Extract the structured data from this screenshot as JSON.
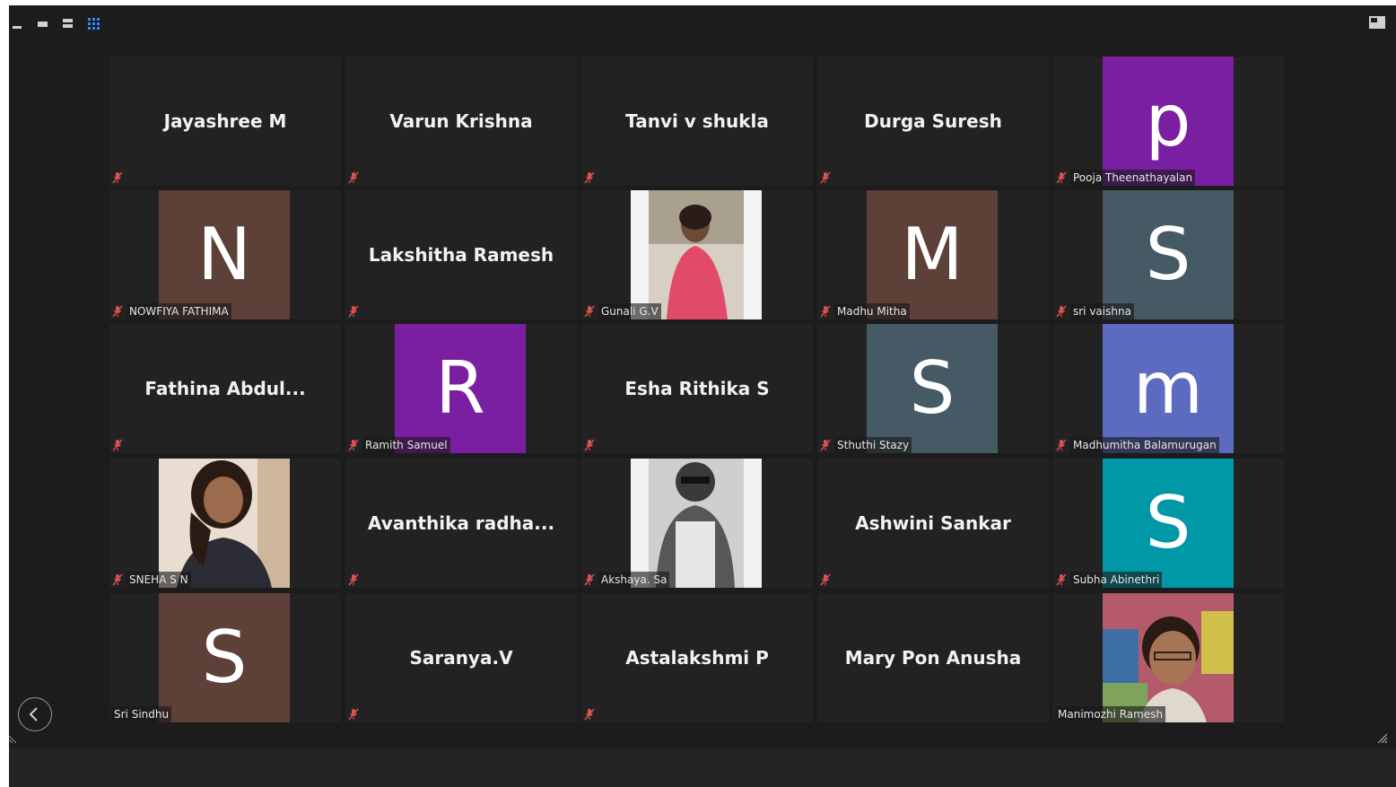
{
  "toolbar": {
    "icons": [
      "minimize-icon",
      "speaker-view-icon",
      "strip-view-icon",
      "gallery-view-icon",
      "exit-fullscreen-icon"
    ],
    "active_color": "#2d8cff"
  },
  "tiles": [
    {
      "kind": "text",
      "name": "Jayashree M",
      "muted": true
    },
    {
      "kind": "text",
      "name": "Varun Krishna",
      "muted": true
    },
    {
      "kind": "text",
      "name": "Tanvi v shukla",
      "muted": true
    },
    {
      "kind": "text",
      "name": "Durga Suresh",
      "muted": true
    },
    {
      "kind": "avatar",
      "letter": "p",
      "color": "#7b1fa2",
      "label": "Pooja Theenathayalan",
      "muted": true
    },
    {
      "kind": "avatar",
      "letter": "N",
      "color": "#5d4037",
      "label": "NOWFIYA FATHIMA",
      "muted": true
    },
    {
      "kind": "text",
      "name": "Lakshitha Ramesh",
      "muted": true
    },
    {
      "kind": "photo",
      "label": "Gunali G.V",
      "muted": true
    },
    {
      "kind": "avatar",
      "letter": "M",
      "color": "#5d4037",
      "label": "Madhu Mitha",
      "muted": true
    },
    {
      "kind": "avatar",
      "letter": "S",
      "color": "#455a64",
      "label": "sri vaishna",
      "muted": true
    },
    {
      "kind": "text",
      "name": "Fathina  Abdul...",
      "muted": true
    },
    {
      "kind": "avatar",
      "letter": "R",
      "color": "#7b1fa2",
      "label": "Ramith Samuel",
      "muted": true
    },
    {
      "kind": "text",
      "name": "Esha Rithika S",
      "muted": true
    },
    {
      "kind": "avatar",
      "letter": "S",
      "color": "#455a64",
      "label": "Sthuthi Stazy",
      "muted": true
    },
    {
      "kind": "avatar",
      "letter": "m",
      "color": "#5c6bc0",
      "label": "Madhumitha Balamurugan",
      "muted": true
    },
    {
      "kind": "photo",
      "label": "SNEHA S N",
      "muted": true
    },
    {
      "kind": "text",
      "name": "Avanthika  radha...",
      "muted": true
    },
    {
      "kind": "photo",
      "label": "Akshaya. Sa",
      "muted": true
    },
    {
      "kind": "text",
      "name": "Ashwini Sankar",
      "muted": true
    },
    {
      "kind": "avatar",
      "letter": "S",
      "color": "#0097a7",
      "label": "Subha Abinethri",
      "muted": true
    },
    {
      "kind": "avatar",
      "letter": "S",
      "color": "#5d4037",
      "label": "Sri Sindhu",
      "muted": false
    },
    {
      "kind": "text",
      "name": "Saranya.V",
      "muted": true
    },
    {
      "kind": "text",
      "name": "Astalakshmi P",
      "muted": true
    },
    {
      "kind": "text",
      "name": "Mary Pon Anusha",
      "muted": false
    },
    {
      "kind": "photo",
      "label": "Manimozhi Ramesh",
      "muted": false
    }
  ],
  "nav": {
    "back_icon": "chevron-left-icon"
  },
  "colors": {
    "background": "#1c1c1c",
    "tile": "#222222",
    "mic_muted": "#d9534f"
  }
}
